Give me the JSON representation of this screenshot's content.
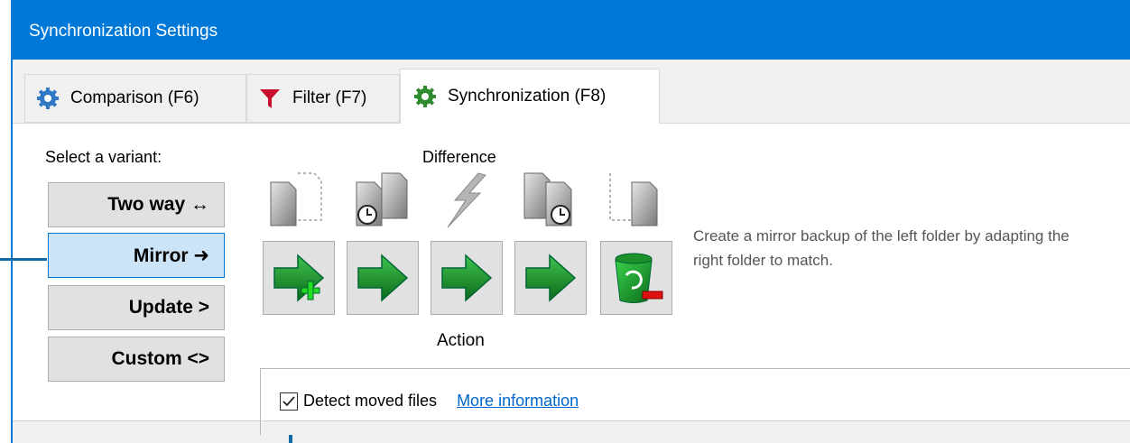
{
  "window": {
    "title": "Synchronization Settings"
  },
  "tabs": [
    {
      "label": "Comparison (F6)",
      "icon": "gear-icon"
    },
    {
      "label": "Filter (F7)",
      "icon": "funnel-icon"
    },
    {
      "label": "Synchronization (F8)",
      "icon": "gear-icon",
      "active": true
    }
  ],
  "variants": {
    "label": "Select a variant:",
    "items": [
      "Two way ↔",
      "Mirror ➜",
      "Update >",
      "Custom <>"
    ],
    "selected": "Mirror ➜"
  },
  "matrix": {
    "difference_label": "Difference",
    "action_label": "Action",
    "categories": [
      "left-only-file-icon",
      "left-newer-file-icon",
      "conflict-icon",
      "right-newer-file-icon",
      "right-only-file-icon"
    ],
    "actions": [
      "create-right-icon",
      "overwrite-right-icon",
      "overwrite-right-icon",
      "overwrite-right-icon",
      "delete-right-icon"
    ]
  },
  "description": "Create a mirror backup of the left folder by adapting the right folder to match.",
  "detect_moved": {
    "label": "Detect moved files",
    "checked": true,
    "link": "More information"
  },
  "colors": {
    "accent": "#0078d7",
    "arrow_green": "#1c8a2e",
    "selection": "#cce4f7"
  }
}
